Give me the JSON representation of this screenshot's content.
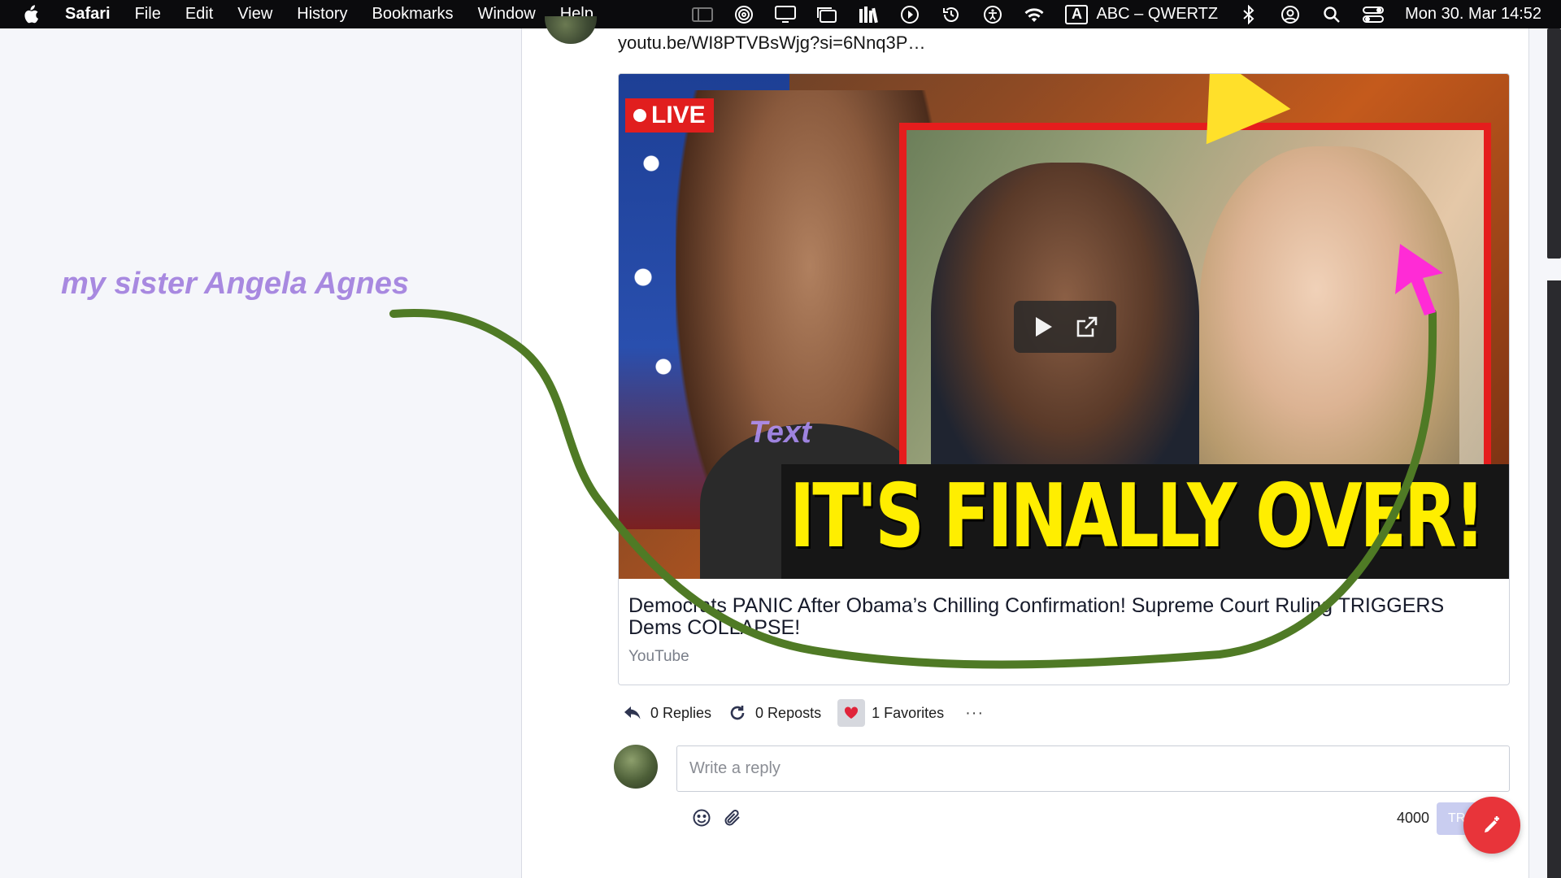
{
  "menubar": {
    "app_name": "Safari",
    "menus": [
      "File",
      "Edit",
      "View",
      "History",
      "Bookmarks",
      "Window",
      "Help"
    ],
    "status_icons": [
      "sidebar-icon",
      "airdrop-icon",
      "display-icon",
      "window-stack-icon",
      "library-icon",
      "play-circle-icon",
      "time-machine-icon",
      "accessibility-icon",
      "wifi-icon"
    ],
    "keyboard_layout_badge": "A",
    "keyboard_layout": "ABC – QWERTZ",
    "clock": "Mon 30. Mar  14:52"
  },
  "post": {
    "link_text": "youtu.be/WI8PTVBsWjg?si=6Nnq3P…",
    "card": {
      "thumbnail": {
        "live_badge": "LIVE",
        "headline": "IT'S FINALLY OVER!",
        "overlay_text": "Text"
      },
      "title": "Democrats PANIC After Obama’s Chilling Confirmation! Supreme Court Ruling TRIGGERS Dems COLLAPSE!",
      "source": "YouTube"
    },
    "actions": {
      "replies": "0 Replies",
      "reposts": "0 Reposts",
      "favorites": "1 Favorites",
      "more": "···"
    },
    "reply": {
      "placeholder": "Write a reply",
      "char_count": "4000",
      "submit_label": "TR"
    }
  },
  "annotations": {
    "label": "my sister Angela Agnes",
    "line_color": "#4f7a25",
    "arrow_color": "#ff2bd6",
    "label_color": "#a889e0"
  },
  "colors": {
    "favorite_heart": "#e0243a",
    "fab": "#e8343a",
    "headline_yellow": "#ffee00"
  }
}
